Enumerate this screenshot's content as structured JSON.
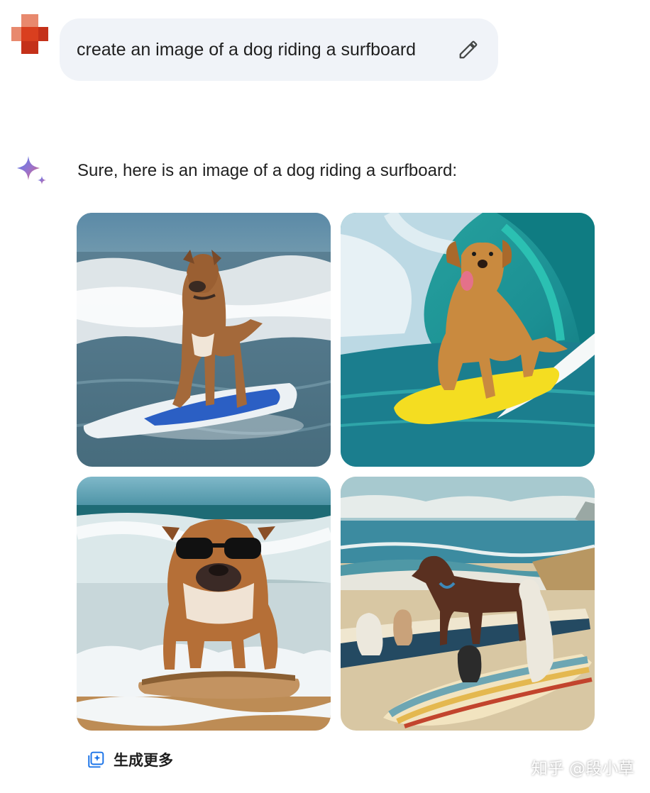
{
  "user": {
    "avatar_icon": "red-cross-avatar-icon"
  },
  "prompt": {
    "text": "create an image of a dog riding a surfboard",
    "edit_icon": "pencil-icon"
  },
  "assistant": {
    "icon": "gemini-sparkle-icon",
    "response": "Sure, here is an image of a dog riding a surfboard:"
  },
  "images": [
    {
      "id": "image-1",
      "subject": "brown dog standing on blue-and-white surfboard in ocean waves"
    },
    {
      "id": "image-2",
      "subject": "golden retriever on yellow surfboard inside turquoise wave"
    },
    {
      "id": "image-3",
      "subject": "bulldog wearing sunglasses on surfboard in foam"
    },
    {
      "id": "image-4",
      "subject": "several dogs on striped surfboards on a beach"
    }
  ],
  "actions": {
    "generate_more": "生成更多",
    "generate_more_icon": "generate-more-icon"
  },
  "watermark": "知乎 @段小草",
  "colors": {
    "bubble": "#f0f3f8",
    "user_avatar": "#d93f1f",
    "text": "#1f1f1f"
  }
}
